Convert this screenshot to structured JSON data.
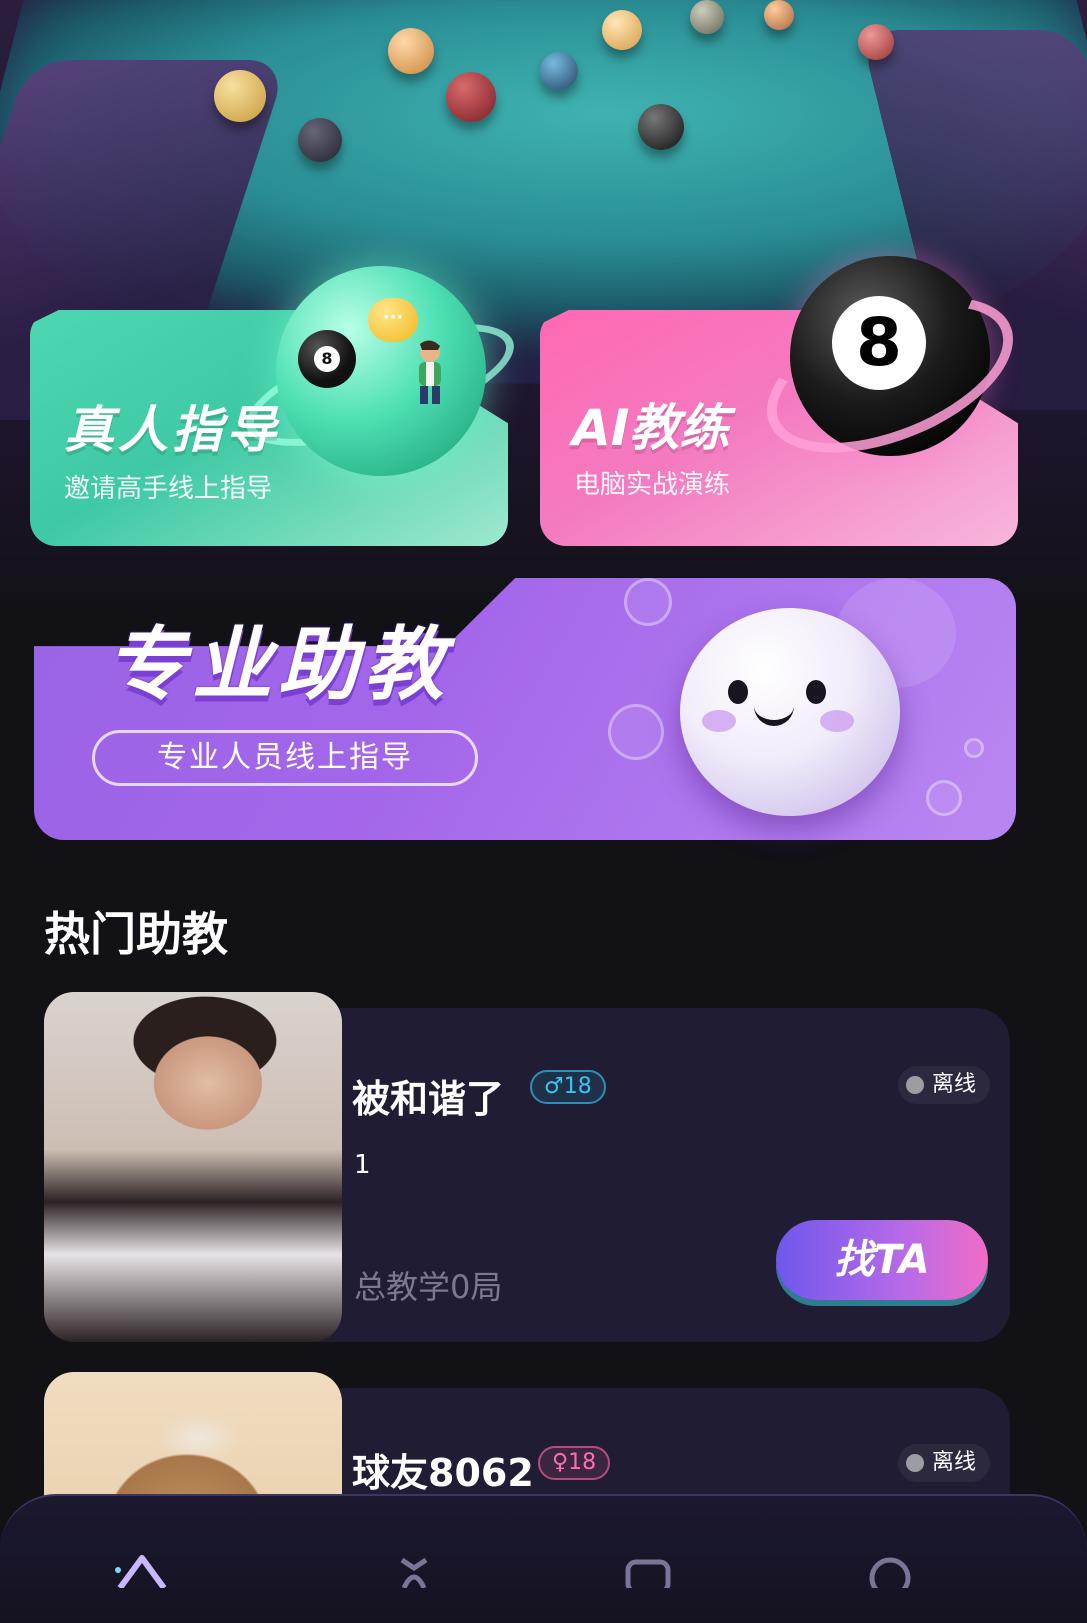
{
  "features": {
    "real_coach": {
      "title": "真人指导",
      "subtitle": "邀请高手线上指导"
    },
    "ai_coach": {
      "title": "AI教练",
      "subtitle": "电脑实战演练",
      "ball_number": "8"
    },
    "pro_assistant": {
      "title": "专业助教",
      "subtitle": "专业人员线上指导"
    },
    "mini_ball_number": "8",
    "chat_glyph": "···"
  },
  "section": {
    "title": "热门助教"
  },
  "assistants": [
    {
      "name": "被和谐了",
      "gender_icon": "male-icon",
      "gender_glyph": "♂",
      "age": "18",
      "status": "离线",
      "intro": "1",
      "stats": "总教学0局",
      "cta": "找TA"
    },
    {
      "name": "球友8062",
      "gender_icon": "female-icon",
      "gender_glyph": "♀",
      "age": "18",
      "status": "离线"
    }
  ],
  "colors": {
    "coach_green": "#4ed8b1",
    "ai_pink": "#ff69b2",
    "assistant_purple": "#a366ea",
    "background": "#121116",
    "card": "#1f1c33"
  },
  "tabbar": {
    "icons": [
      "home-icon",
      "coach-icon",
      "message-icon",
      "profile-icon"
    ]
  }
}
